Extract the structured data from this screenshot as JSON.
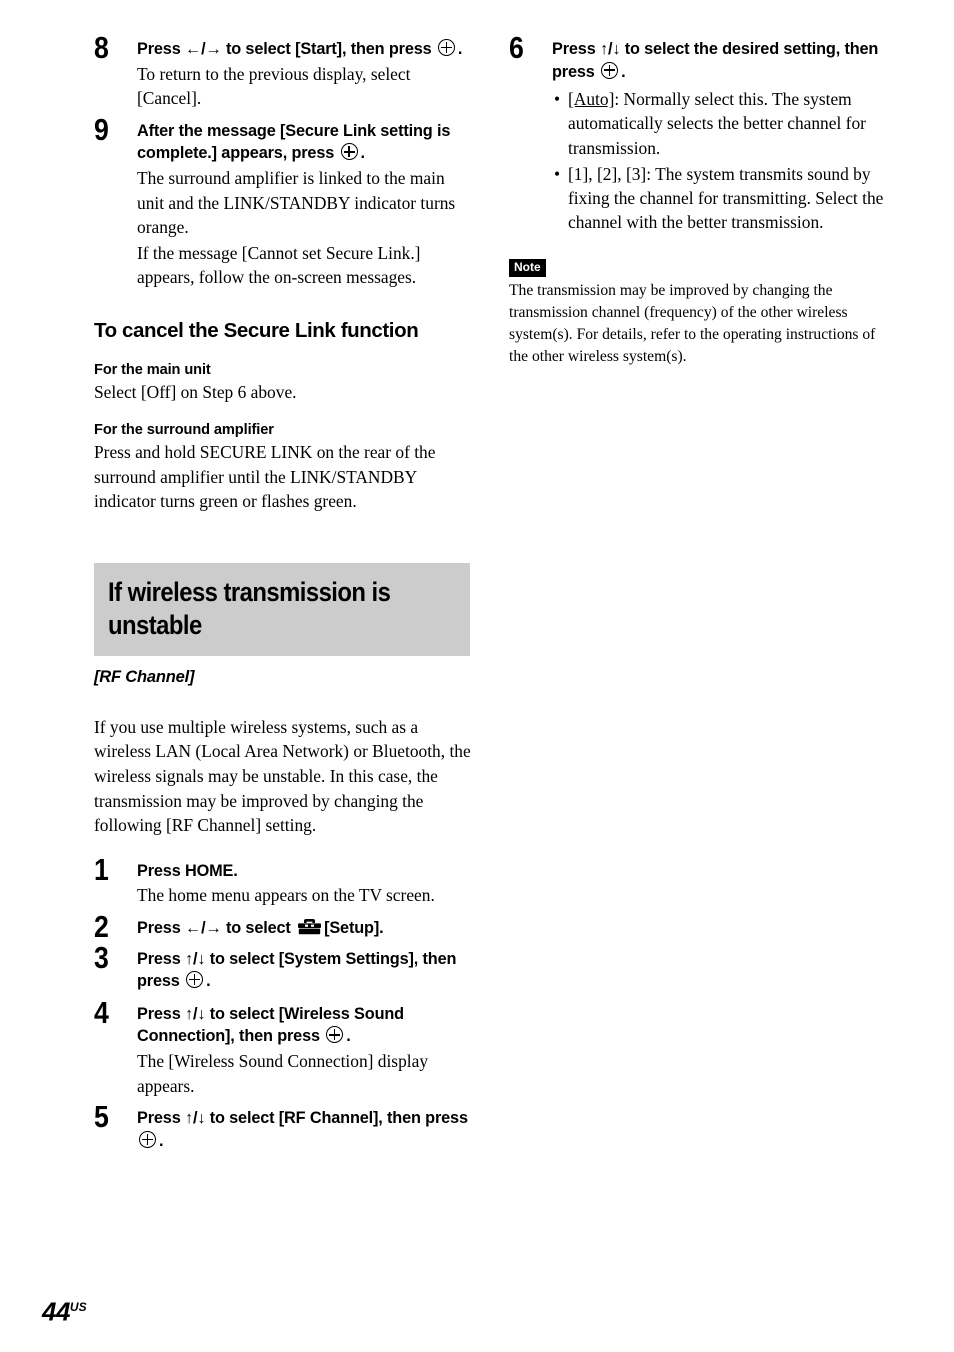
{
  "page": {
    "number": "44",
    "region_suffix": "US"
  },
  "left_column": {
    "step8": {
      "num": "8",
      "title_before_icon": "Press ←/→ to select [Start], then press",
      "title_after_icon": ".",
      "body": "To return to the previous display, select [Cancel]."
    },
    "step9": {
      "num": "9",
      "title_before_icon": "After the message [Secure Link setting is complete.] appears, press",
      "title_after_icon": ".",
      "body1": "The surround amplifier is linked to the main unit and the LINK/STANDBY indicator turns orange.",
      "body2": "If the message [Cannot set Secure Link.] appears, follow the on-screen messages."
    },
    "cancel_section": {
      "heading": "To cancel the Secure Link function",
      "main_unit_label": "For the main unit",
      "main_unit_body": "Select [Off] on Step 6 above.",
      "surround_amp_label": "For the surround amplifier",
      "surround_amp_body": "Press and hold SECURE LINK on the rear of the surround amplifier until the LINK/STANDBY indicator turns green or flashes green."
    },
    "unstable_section": {
      "banner_title": "If wireless transmission is unstable",
      "banner_subtitle": "[RF Channel]",
      "intro": "If you use multiple wireless systems, such as a wireless LAN (Local Area Network) or Bluetooth, the wireless signals may be unstable. In this case, the transmission may be improved by changing the following [RF Channel] setting."
    },
    "step1": {
      "num": "1",
      "title": "Press HOME.",
      "body": "The home menu appears on the TV screen."
    },
    "step2": {
      "num": "2",
      "title_before_icon": "Press ←/→ to select",
      "title_after_icon": "[Setup]."
    },
    "step3": {
      "num": "3",
      "title_before_icon": "Press ↑/↓ to select [System Settings], then press",
      "title_after_icon": "."
    },
    "step4": {
      "num": "4",
      "title_before_icon": "Press ↑/↓ to select [Wireless Sound Connection], then press",
      "title_after_icon": ".",
      "body": "The [Wireless Sound Connection] display appears."
    },
    "step5": {
      "num": "5",
      "title_before_icon": "Press ↑/↓ to select [RF Channel], then press",
      "title_after_icon": "."
    }
  },
  "right_column": {
    "step6": {
      "num": "6",
      "title_before_icon": "Press ↑/↓ to select the desired setting, then press",
      "title_after_icon": ".",
      "bullets": [
        {
          "underlined": "[Auto]",
          "rest": ": Normally select this. The system automatically selects the better channel for transmission."
        },
        {
          "underlined": "",
          "rest": "[1], [2], [3]: The system transmits sound by fixing the channel for transmitting. Select the channel with the better transmission."
        }
      ]
    },
    "note": {
      "badge": "Note",
      "body": "The transmission may be improved by changing the transmission channel (frequency) of the other wireless system(s). For details, refer to the operating instructions of the other wireless system(s)."
    }
  }
}
